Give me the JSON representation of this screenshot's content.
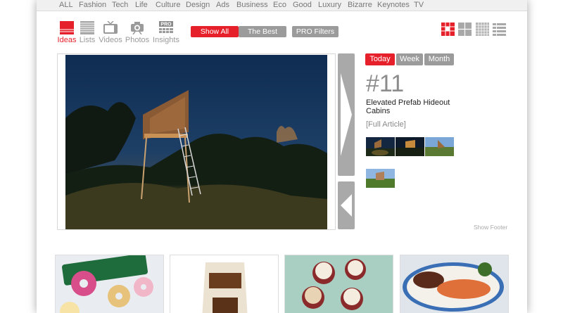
{
  "nav": [
    "ALL",
    "Fashion",
    "Tech",
    "Life",
    "Culture",
    "Design",
    "Ads",
    "Business",
    "Eco",
    "Good",
    "Luxury",
    "Bizarre",
    "Keynotes",
    "TV"
  ],
  "content_types": [
    {
      "label": "Ideas",
      "icon": "ideas-icon"
    },
    {
      "label": "Lists",
      "icon": "lists-icon"
    },
    {
      "label": "Videos",
      "icon": "tv-icon"
    },
    {
      "label": "Photos",
      "icon": "camera-icon"
    },
    {
      "label": "Insights",
      "icon": "pro-insights-icon",
      "badge": "PRO"
    }
  ],
  "filters": {
    "show_all": "Show All",
    "the_best": "The Best",
    "pro_filters": "PRO Filters"
  },
  "views": [
    "grid-large-icon",
    "grid-medium-icon",
    "grid-small-icon",
    "list-view-icon"
  ],
  "period_tabs": [
    "Today",
    "Week",
    "Month"
  ],
  "feature": {
    "rank": "#11",
    "title": "Elevated Prefab Hideout Cabins",
    "full_article": "[Full Article]"
  },
  "show_footer": "Show Footer",
  "colors": {
    "accent": "#e6202a",
    "gray_button": "#9b9b9b",
    "arrow": "#a9a9a9"
  }
}
